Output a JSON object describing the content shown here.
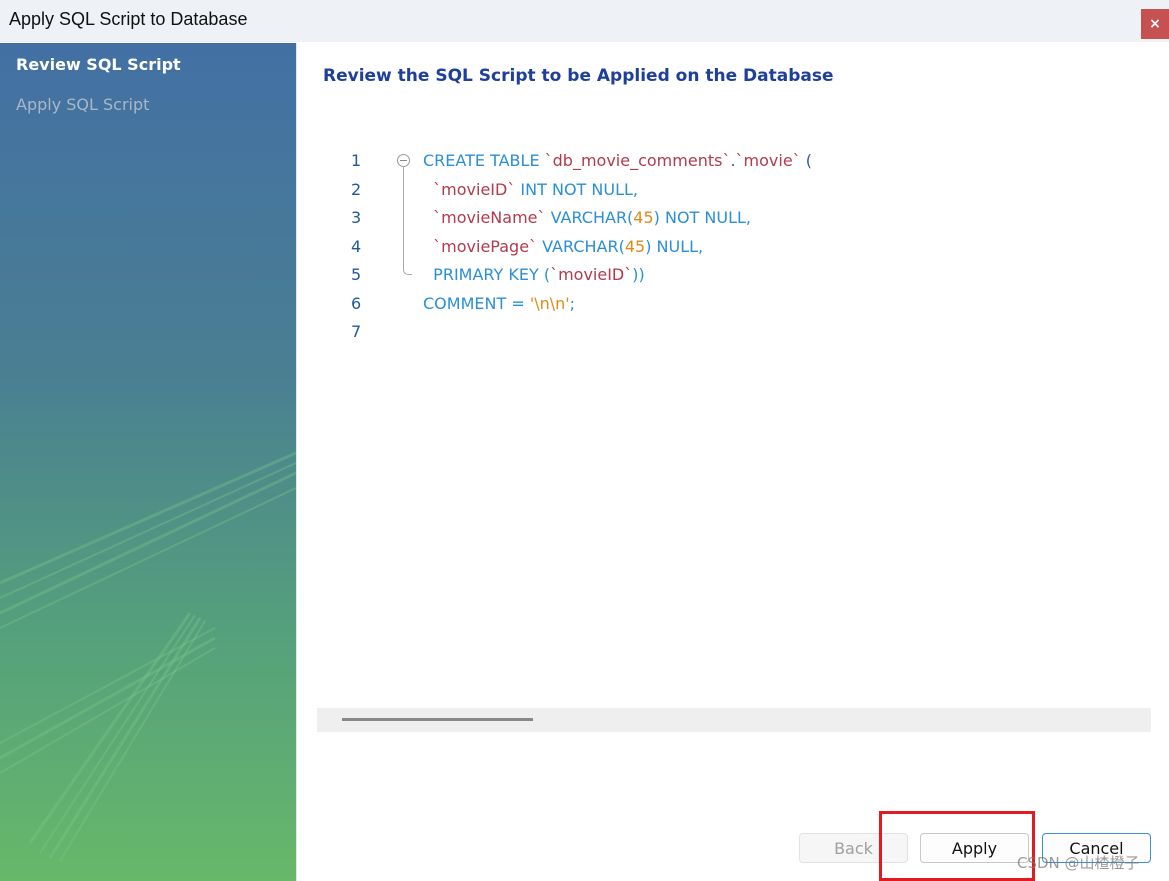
{
  "window": {
    "title": "Apply SQL Script to Database",
    "close_label": "×"
  },
  "sidebar": {
    "items": [
      {
        "label": "Review SQL Script",
        "active": true
      },
      {
        "label": "Apply SQL Script",
        "active": false
      }
    ]
  },
  "main": {
    "heading": "Review the SQL Script to be Applied on the Database"
  },
  "editor": {
    "lines": [
      {
        "num": "1",
        "tokens": [
          {
            "t": "CREATE TABLE ",
            "c": "kw"
          },
          {
            "t": "`db_movie_comments`",
            "c": "id"
          },
          {
            "t": ".",
            "c": "plain"
          },
          {
            "t": "`movie`",
            "c": "id"
          },
          {
            "t": " (",
            "c": "plain"
          }
        ]
      },
      {
        "num": "2",
        "tokens": [
          {
            "t": "  `movieID`",
            "c": "id"
          },
          {
            "t": " INT NOT NULL,",
            "c": "kw"
          }
        ]
      },
      {
        "num": "3",
        "tokens": [
          {
            "t": "  `movieName`",
            "c": "id"
          },
          {
            "t": " VARCHAR(",
            "c": "kw"
          },
          {
            "t": "45",
            "c": "num"
          },
          {
            "t": ") NOT NULL,",
            "c": "kw"
          }
        ]
      },
      {
        "num": "4",
        "tokens": [
          {
            "t": "  `moviePage`",
            "c": "id"
          },
          {
            "t": " VARCHAR(",
            "c": "kw"
          },
          {
            "t": "45",
            "c": "num"
          },
          {
            "t": ") NULL,",
            "c": "kw"
          }
        ]
      },
      {
        "num": "5",
        "tokens": [
          {
            "t": "  PRIMARY KEY (",
            "c": "kw"
          },
          {
            "t": "`movieID`",
            "c": "id"
          },
          {
            "t": "))",
            "c": "kw"
          }
        ]
      },
      {
        "num": "6",
        "tokens": [
          {
            "t": "COMMENT = ",
            "c": "kw"
          },
          {
            "t": "'\\n\\n'",
            "c": "str"
          },
          {
            "t": ";",
            "c": "kw"
          }
        ]
      },
      {
        "num": "7",
        "tokens": []
      }
    ]
  },
  "buttons": {
    "back": "Back",
    "apply": "Apply",
    "cancel": "Cancel"
  },
  "watermark": "CSDN @山楂橙子",
  "colors": {
    "keyword": "#2a8fd6",
    "identifier": "#b23a4e",
    "number": "#e08a1a",
    "heading": "#1e3f9a",
    "highlight": "#e21b22"
  }
}
